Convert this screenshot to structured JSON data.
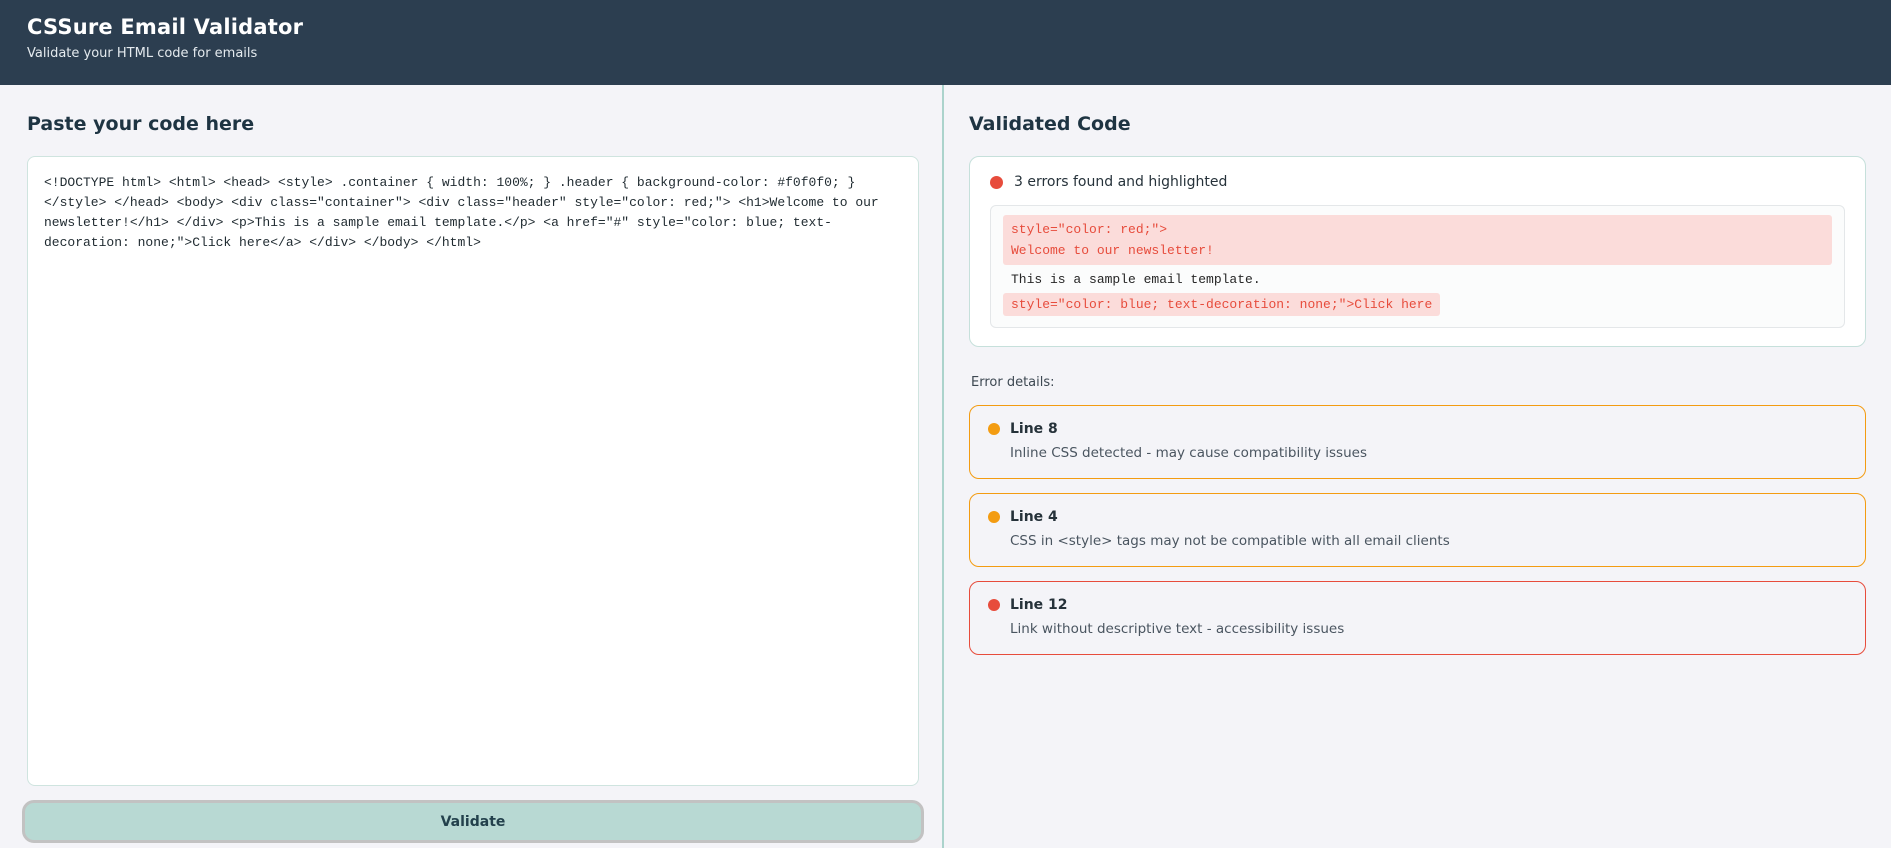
{
  "header": {
    "title": "CSSure Email Validator",
    "subtitle": "Validate your HTML code for emails"
  },
  "left_panel": {
    "heading": "Paste your code here",
    "code_input": "<!DOCTYPE html> <html> <head> <style> .container { width: 100%; } .header { background-color: #f0f0f0; } </style> </head> <body> <div class=\"container\"> <div class=\"header\" style=\"color: red;\"> <h1>Welcome to our newsletter!</h1> </div> <p>This is a sample email template.</p> <a href=\"#\" style=\"color: blue; text-decoration: none;\">Click here</a> </div> </body> </html>",
    "validate_button": "Validate"
  },
  "right_panel": {
    "heading": "Validated Code",
    "summary": "3 errors found and highlighted",
    "validated_code": {
      "highlighted_block": [
        "style=\"color: red;\">",
        "Welcome to our newsletter!"
      ],
      "plain_line": "This is a sample email template.",
      "highlighted_inline": "style=\"color: blue; text-decoration: none;\">Click here"
    },
    "error_details_label": "Error details:",
    "errors": [
      {
        "line": "Line 8",
        "message": "Inline CSS detected - may cause compatibility issues",
        "severity": "warning"
      },
      {
        "line": "Line 4",
        "message": "CSS in <style> tags may not be compatible with all email clients",
        "severity": "warning"
      },
      {
        "line": "Line 12",
        "message": "Link without descriptive text - accessibility issues",
        "severity": "error"
      }
    ]
  },
  "colors": {
    "header_bg": "#2c3e50",
    "error_red": "#e74c3c",
    "warning_orange": "#f39c12",
    "highlight_pink": "#fbdcda",
    "button_mint": "#b8d9d3",
    "accent_teal": "#abd3cc"
  }
}
